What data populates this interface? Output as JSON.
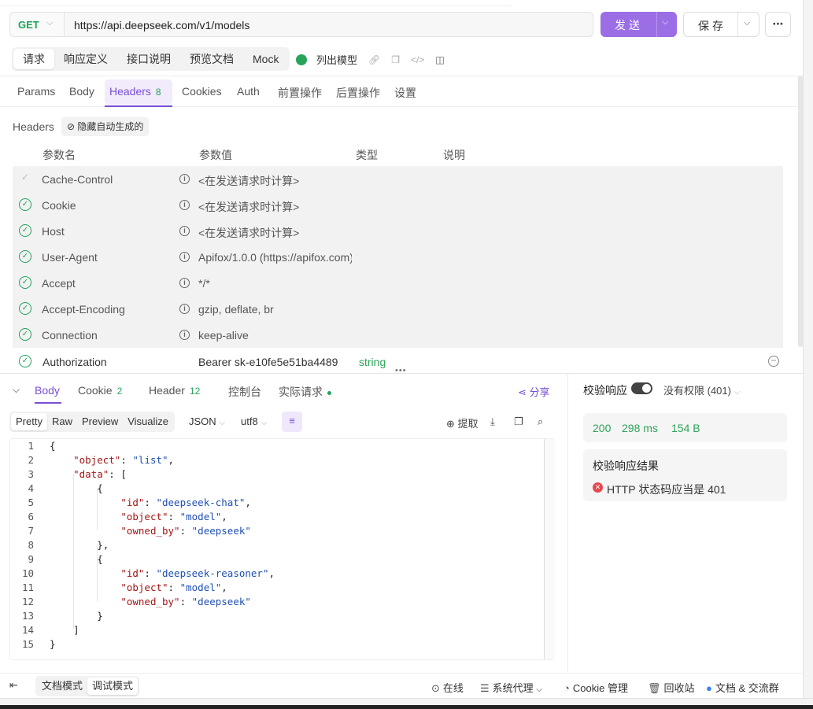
{
  "request": {
    "method": "GET",
    "url": "https://api.deepseek.com/v1/models",
    "send_label": "发送",
    "save_label": "保存"
  },
  "doc_tabs": [
    "请求",
    "响应定义",
    "接口说明",
    "预览文档",
    "Mock"
  ],
  "endpoint_name": "列出模型",
  "param_tabs": [
    {
      "label": "Params"
    },
    {
      "label": "Body"
    },
    {
      "label": "Headers",
      "badge": "8"
    },
    {
      "label": "Cookies"
    },
    {
      "label": "Auth"
    },
    {
      "label": "前置操作"
    },
    {
      "label": "后置操作"
    },
    {
      "label": "设置"
    }
  ],
  "headers_section": {
    "label": "Headers",
    "hide_auto_label": "隐藏自动生成的",
    "columns": [
      "参数名",
      "参数值",
      "类型",
      "说明"
    ],
    "auto_rows": [
      {
        "name": "Cache-Control",
        "value": "<在发送请求时计算>"
      },
      {
        "name": "Cookie",
        "value": "<在发送请求时计算>"
      },
      {
        "name": "Host",
        "value": "<在发送请求时计算>"
      },
      {
        "name": "User-Agent",
        "value": "Apifox/1.0.0 (https://apifox.com)"
      },
      {
        "name": "Accept",
        "value": "*/*"
      },
      {
        "name": "Accept-Encoding",
        "value": "gzip, deflate, br"
      },
      {
        "name": "Connection",
        "value": "keep-alive"
      }
    ],
    "auth_row": {
      "name": "Authorization",
      "value": "Bearer sk-e10fe5e51ba4489",
      "type": "string"
    }
  },
  "response": {
    "tabs": [
      {
        "label": "Body"
      },
      {
        "label": "Cookie",
        "badge": "2"
      },
      {
        "label": "Header",
        "badge": "12"
      },
      {
        "label": "控制台"
      },
      {
        "label": "实际请求"
      }
    ],
    "share_label": "分享",
    "formats": [
      "Pretty",
      "Raw",
      "Preview",
      "Visualize"
    ],
    "lang": "JSON",
    "encoding": "utf8",
    "extract_label": "提取",
    "code_lines": [
      "{",
      "    \"object\": \"list\",",
      "    \"data\": [",
      "        {",
      "            \"id\": \"deepseek-chat\",",
      "            \"object\": \"model\",",
      "            \"owned_by\": \"deepseek\"",
      "        },",
      "        {",
      "            \"id\": \"deepseek-reasoner\",",
      "            \"object\": \"model\",",
      "            \"owned_by\": \"deepseek\"",
      "        }",
      "    ]",
      "}"
    ]
  },
  "validation": {
    "label": "校验响应",
    "mode": "没有权限 (401)",
    "status": "200",
    "time": "298 ms",
    "size": "154 B",
    "result_title": "校验响应结果",
    "result_message": "HTTP 状态码应当是 401"
  },
  "footer": {
    "modes": [
      "文档模式",
      "调试模式"
    ],
    "online": "在线",
    "proxy": "系统代理",
    "cookie": "Cookie 管理",
    "trash": "回收站",
    "community": "文档 & 交流群"
  }
}
